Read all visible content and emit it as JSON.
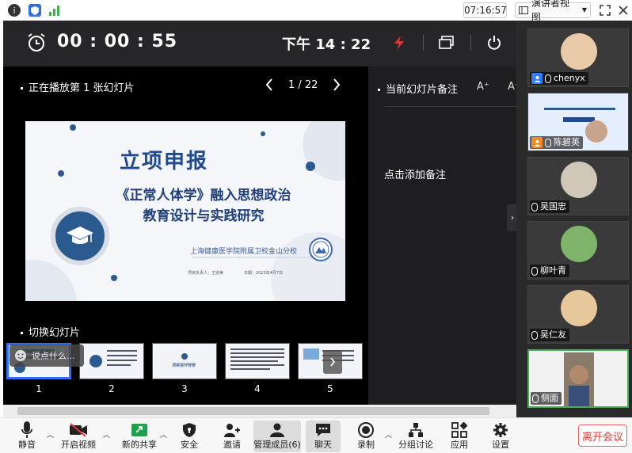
{
  "topbar": {
    "clock": "07:16:57",
    "view_selector": "演讲者视图",
    "icons": [
      "info-icon",
      "shield-icon",
      "signal-icon",
      "fullscreen-icon",
      "close-icon"
    ]
  },
  "presenter": {
    "timer": "00 : 00 : 55",
    "time_of_day": "下午 14 : 22",
    "now_playing": "正在播放第 1 张幻灯片",
    "page": "1 / 22",
    "notes_title": "当前幻灯片备注",
    "font_inc": "A⁺",
    "font_dec": "A⁻",
    "notes_placeholder": "点击添加备注",
    "thumbs_label": "切换幻灯片",
    "slide": {
      "title": "立项申报",
      "subtitle_line1": "《正常人体学》融入思想政治",
      "subtitle_line2": "教育设计与实践研究",
      "school": "上海健康医学院附属卫校金山分校",
      "meta_left": "项目负责人：王进美",
      "meta_right": "日期：2023年4月7日"
    },
    "thumbnails": [
      {
        "num": "1",
        "caption": ""
      },
      {
        "num": "2",
        "caption": ""
      },
      {
        "num": "3",
        "caption": "项目设计背景"
      },
      {
        "num": "4",
        "caption": ""
      },
      {
        "num": "5",
        "caption": ""
      }
    ],
    "chat_placeholder": "说点什么..."
  },
  "participants": [
    {
      "name": "chenyx"
    },
    {
      "name": "陈碧英"
    },
    {
      "name": "吴国忠"
    },
    {
      "name": "柳叶青"
    },
    {
      "name": "吴仁友"
    },
    {
      "name": "侧面"
    }
  ],
  "toolbar": {
    "mute": "静音",
    "video": "开启视频",
    "share": "新的共享",
    "security": "安全",
    "invite": "邀请",
    "members": "管理成员(6)",
    "chat": "聊天",
    "record": "录制",
    "breakout": "分组讨论",
    "apps": "应用",
    "settings": "设置",
    "leave": "离开会议"
  },
  "colors": {
    "accent_blue": "#2f6fff",
    "leave_red": "#e53935",
    "active_green": "#3fb24f",
    "slide_title_blue": "#1f4a8c"
  }
}
